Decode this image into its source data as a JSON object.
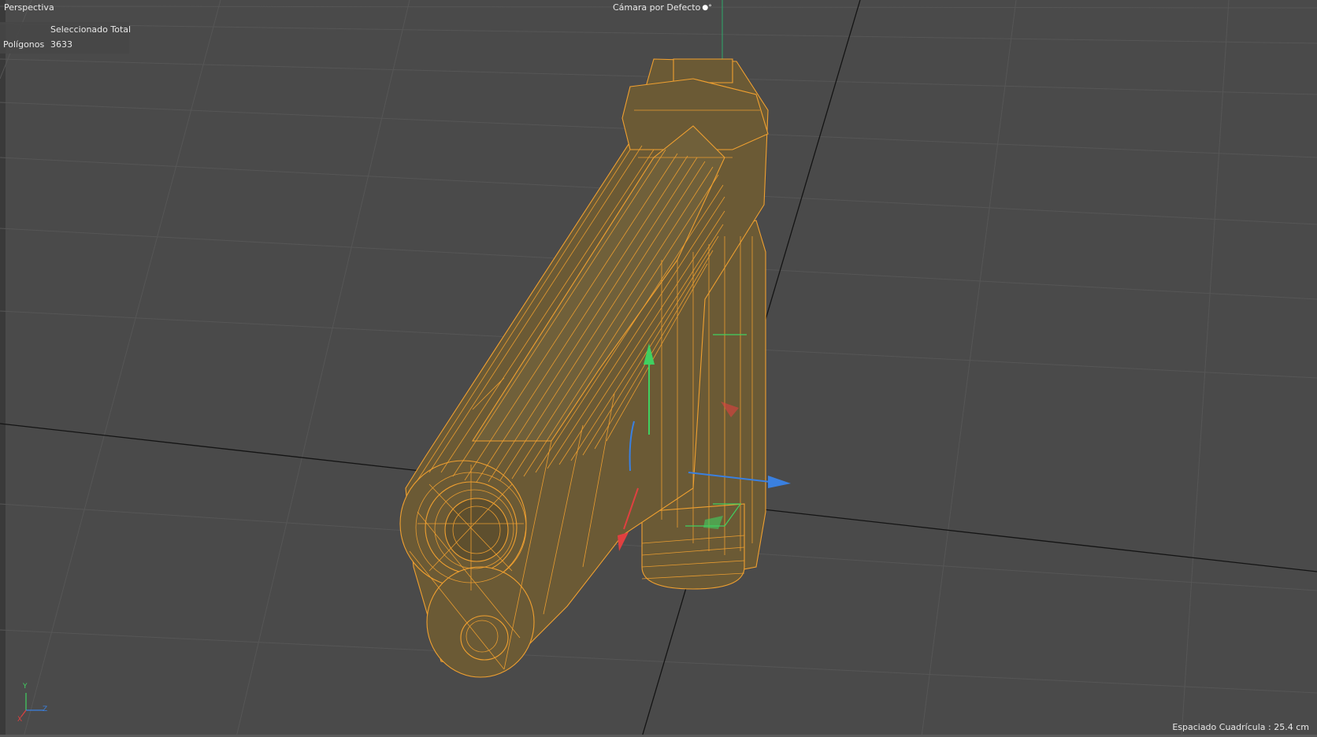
{
  "viewport": {
    "view_name": "Perspectiva",
    "camera_name": "Cámara por Defecto",
    "camera_icon": "eye-icon",
    "stats": {
      "header": "Seleccionado Total",
      "label": "Polígonos",
      "value": "3633"
    },
    "grid_spacing": "Espaciado Cuadrícula : 25.4 cm",
    "axis_indicator": {
      "y": "Y",
      "z": "Z",
      "x": "X"
    }
  },
  "colors": {
    "background": "#4a4a4a",
    "grid_line": "#565656",
    "horizon_line": "#141414",
    "mesh_fill": "#6b5a35",
    "mesh_wire": "#f0a030",
    "axis_x": "#e04040",
    "axis_y": "#40d060",
    "axis_z": "#3a80e0"
  }
}
